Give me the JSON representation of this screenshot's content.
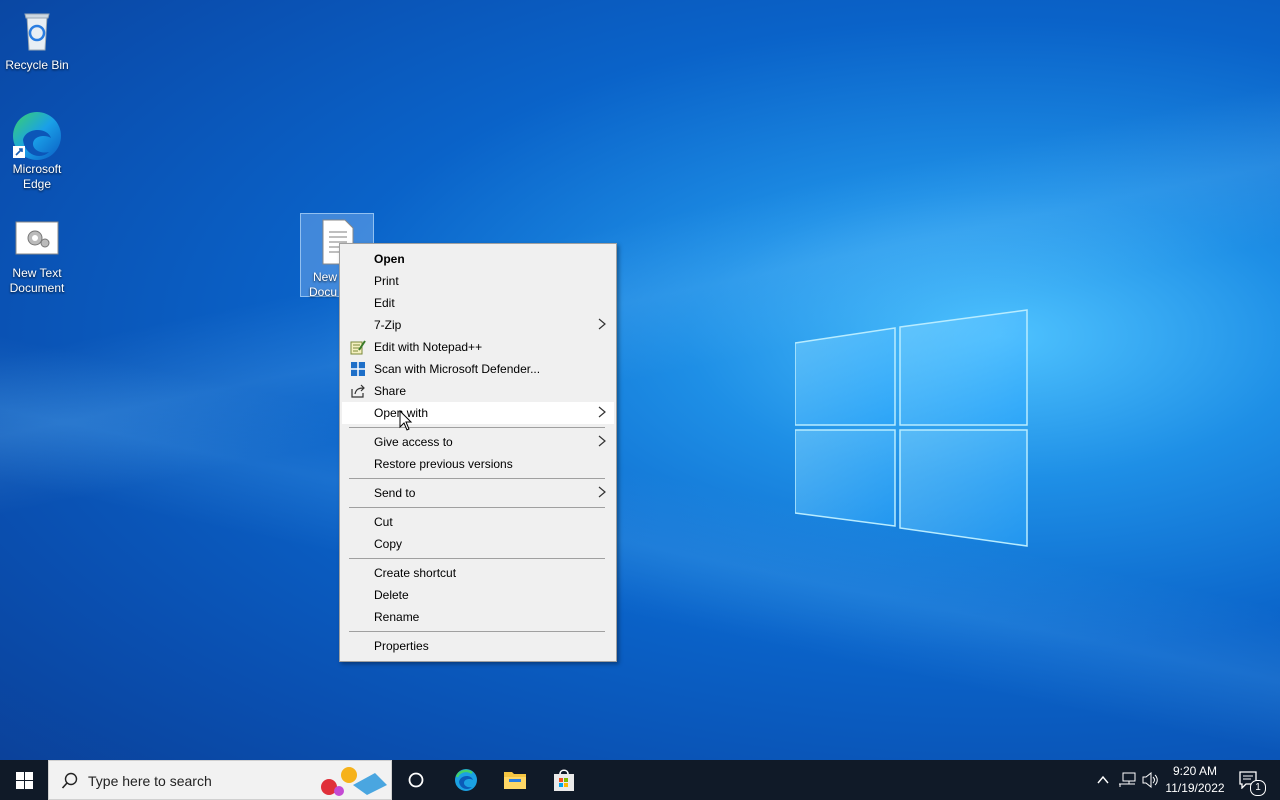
{
  "desktop": {
    "icons": [
      {
        "label": "Recycle Bin"
      },
      {
        "label_line1": "Microsoft",
        "label_line2": "Edge"
      },
      {
        "label_line1": "New Text",
        "label_line2": "Document"
      },
      {
        "label_line1": "New",
        "label_line2": "Docu"
      }
    ]
  },
  "context_menu": {
    "items": [
      {
        "label": "Open"
      },
      {
        "label": "Print"
      },
      {
        "label": "Edit"
      },
      {
        "label": "7-Zip"
      },
      {
        "label": "Edit with Notepad++"
      },
      {
        "label": "Scan with Microsoft Defender..."
      },
      {
        "label": "Share"
      },
      {
        "label": "Open with"
      },
      {
        "label": "Give access to"
      },
      {
        "label": "Restore previous versions"
      },
      {
        "label": "Send to"
      },
      {
        "label": "Cut"
      },
      {
        "label": "Copy"
      },
      {
        "label": "Create shortcut"
      },
      {
        "label": "Delete"
      },
      {
        "label": "Rename"
      },
      {
        "label": "Properties"
      }
    ]
  },
  "taskbar": {
    "search_placeholder": "Type here to search",
    "clock_time": "9:20 AM",
    "clock_date": "11/19/2022",
    "notification_count": "1"
  },
  "colors": {
    "accent": "#0078d7",
    "taskbar": "#101a28",
    "menu_bg": "#f0f0f0"
  }
}
